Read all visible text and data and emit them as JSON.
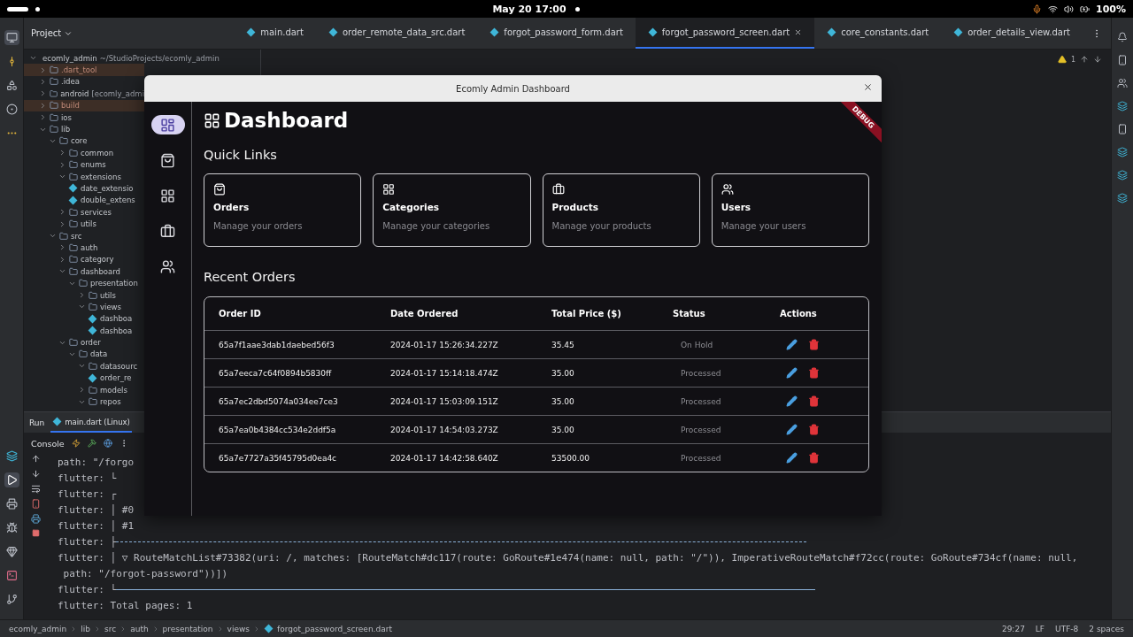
{
  "system_bar": {
    "date_time": "May 20  17:00",
    "battery": "100%"
  },
  "ide": {
    "project_header": "Project",
    "editor_tabs": [
      {
        "label": "main.dart",
        "selected": false
      },
      {
        "label": "order_remote_data_src.dart",
        "selected": false
      },
      {
        "label": "forgot_password_form.dart",
        "selected": false
      },
      {
        "label": "forgot_password_screen.dart",
        "selected": true
      },
      {
        "label": "core_constants.dart",
        "selected": false
      },
      {
        "label": "order_details_view.dart",
        "selected": false
      }
    ],
    "project_tree": [
      {
        "kind": "folder",
        "name": "ecomly_admin",
        "note": "~/StudioProjects/ecomly_admin",
        "expanded": true,
        "children": [
          {
            "kind": "folder",
            "name": ".dart_tool",
            "excluded": true,
            "expanded": false
          },
          {
            "kind": "folder",
            "name": ".idea",
            "expanded": false
          },
          {
            "kind": "folder",
            "name": "android",
            "note": "[ecomly_admi",
            "expanded": false
          },
          {
            "kind": "folder",
            "name": "build",
            "excluded": true,
            "expanded": false
          },
          {
            "kind": "folder",
            "name": "ios",
            "expanded": false
          },
          {
            "kind": "folder",
            "name": "lib",
            "expanded": true,
            "children": [
              {
                "kind": "folder",
                "name": "core",
                "expanded": true,
                "children": [
                  {
                    "kind": "folder",
                    "name": "common",
                    "expanded": false
                  },
                  {
                    "kind": "folder",
                    "name": "enums",
                    "expanded": false
                  },
                  {
                    "kind": "folder",
                    "name": "extensions",
                    "expanded": true,
                    "children": [
                      {
                        "kind": "file",
                        "name": "date_extensio"
                      },
                      {
                        "kind": "file",
                        "name": "double_extens"
                      }
                    ]
                  },
                  {
                    "kind": "folder",
                    "name": "services",
                    "expanded": false
                  },
                  {
                    "kind": "folder",
                    "name": "utils",
                    "expanded": false
                  }
                ]
              },
              {
                "kind": "folder",
                "name": "src",
                "expanded": true,
                "children": [
                  {
                    "kind": "folder",
                    "name": "auth",
                    "expanded": false
                  },
                  {
                    "kind": "folder",
                    "name": "category",
                    "expanded": false
                  },
                  {
                    "kind": "folder",
                    "name": "dashboard",
                    "expanded": true,
                    "children": [
                      {
                        "kind": "folder",
                        "name": "presentation",
                        "expanded": true,
                        "children": [
                          {
                            "kind": "folder",
                            "name": "utils",
                            "expanded": false
                          },
                          {
                            "kind": "folder",
                            "name": "views",
                            "expanded": true,
                            "children": [
                              {
                                "kind": "file",
                                "name": "dashboa"
                              },
                              {
                                "kind": "file",
                                "name": "dashboa"
                              }
                            ]
                          }
                        ]
                      }
                    ]
                  },
                  {
                    "kind": "folder",
                    "name": "order",
                    "expanded": true,
                    "children": [
                      {
                        "kind": "folder",
                        "name": "data",
                        "expanded": true,
                        "children": [
                          {
                            "kind": "folder",
                            "name": "datasourc",
                            "expanded": true,
                            "children": [
                              {
                                "kind": "file",
                                "name": "order_re"
                              }
                            ]
                          },
                          {
                            "kind": "folder",
                            "name": "models",
                            "expanded": false
                          },
                          {
                            "kind": "folder",
                            "name": "repos",
                            "expanded": true
                          }
                        ]
                      }
                    ]
                  }
                ]
              }
            ]
          }
        ]
      }
    ],
    "warning_count": "1",
    "run_panel": {
      "title": "Run",
      "tabs": [
        {
          "label": "main.dart (Linux)",
          "selected": true
        }
      ],
      "console_tab": "Console",
      "lines": [
        {
          "kind": "text",
          "text": "path: \"/forgo"
        },
        {
          "kind": "text",
          "text": "flutter: └"
        },
        {
          "kind": "text",
          "text": "flutter: ┌"
        },
        {
          "kind": "text",
          "text": "flutter: │ #0"
        },
        {
          "kind": "text",
          "text": "flutter: │ #1"
        },
        {
          "kind": "dashed_rule",
          "text": "flutter: ├"
        },
        {
          "kind": "text",
          "text": "flutter: │ ▽ RouteMatchList#73382(uri: /, matches: [RouteMatch#dc117(route: GoRoute#1e474(name: null, path: \"/\")), ImperativeRouteMatch#f72cc(route: GoRoute#734cf(name: null,"
        },
        {
          "kind": "text",
          "text": " path: \"/forgot-password\"))])"
        },
        {
          "kind": "solid_rule",
          "text": "flutter: └"
        },
        {
          "kind": "text",
          "text": "flutter: Total pages: 1"
        }
      ]
    },
    "status_bar": {
      "breadcrumb": [
        "ecomly_admin",
        "lib",
        "src",
        "auth",
        "presentation",
        "views",
        "forgot_password_screen.dart"
      ],
      "position": "29:27",
      "line_ending": "LF",
      "encoding": "UTF-8",
      "indent": "2 spaces"
    }
  },
  "app_window": {
    "title": "Ecomly Admin Dashboard",
    "debug_banner": "DEBUG",
    "nav": [
      {
        "kind": "dashboard",
        "selected": true
      },
      {
        "kind": "orders",
        "selected": false
      },
      {
        "kind": "categories",
        "selected": false
      },
      {
        "kind": "products",
        "selected": false
      },
      {
        "kind": "users",
        "selected": false
      }
    ],
    "page_title": "Dashboard",
    "quick_links_title": "Quick Links",
    "quick_links": [
      {
        "kind": "orders",
        "title": "Orders",
        "subtitle": "Manage your orders"
      },
      {
        "kind": "categories",
        "title": "Categories",
        "subtitle": "Manage your categories"
      },
      {
        "kind": "products",
        "title": "Products",
        "subtitle": "Manage your products"
      },
      {
        "kind": "users",
        "title": "Users",
        "subtitle": "Manage your users"
      }
    ],
    "recent_orders_title": "Recent Orders",
    "table": {
      "columns": [
        "Order ID",
        "Date Ordered",
        "Total Price ($)",
        "Status",
        "Actions"
      ],
      "rows": [
        {
          "order_id": "65a7f1aae3dab1daebed56f3",
          "date": "2024-01-17 15:26:34.227Z",
          "total": "35.45",
          "status": "On Hold"
        },
        {
          "order_id": "65a7eeca7c64f0894b5830ff",
          "date": "2024-01-17 15:14:18.474Z",
          "total": "35.00",
          "status": "Processed"
        },
        {
          "order_id": "65a7ec2dbd5074a034ee7ce3",
          "date": "2024-01-17 15:03:09.151Z",
          "total": "35.00",
          "status": "Processed"
        },
        {
          "order_id": "65a7ea0b4384cc534e2ddf5a",
          "date": "2024-01-17 14:54:03.273Z",
          "total": "35.00",
          "status": "Processed"
        },
        {
          "order_id": "65a7e7727a35f45795d0ea4c",
          "date": "2024-01-17 14:42:58.640Z",
          "total": "53500.00",
          "status": "Processed"
        }
      ]
    }
  }
}
